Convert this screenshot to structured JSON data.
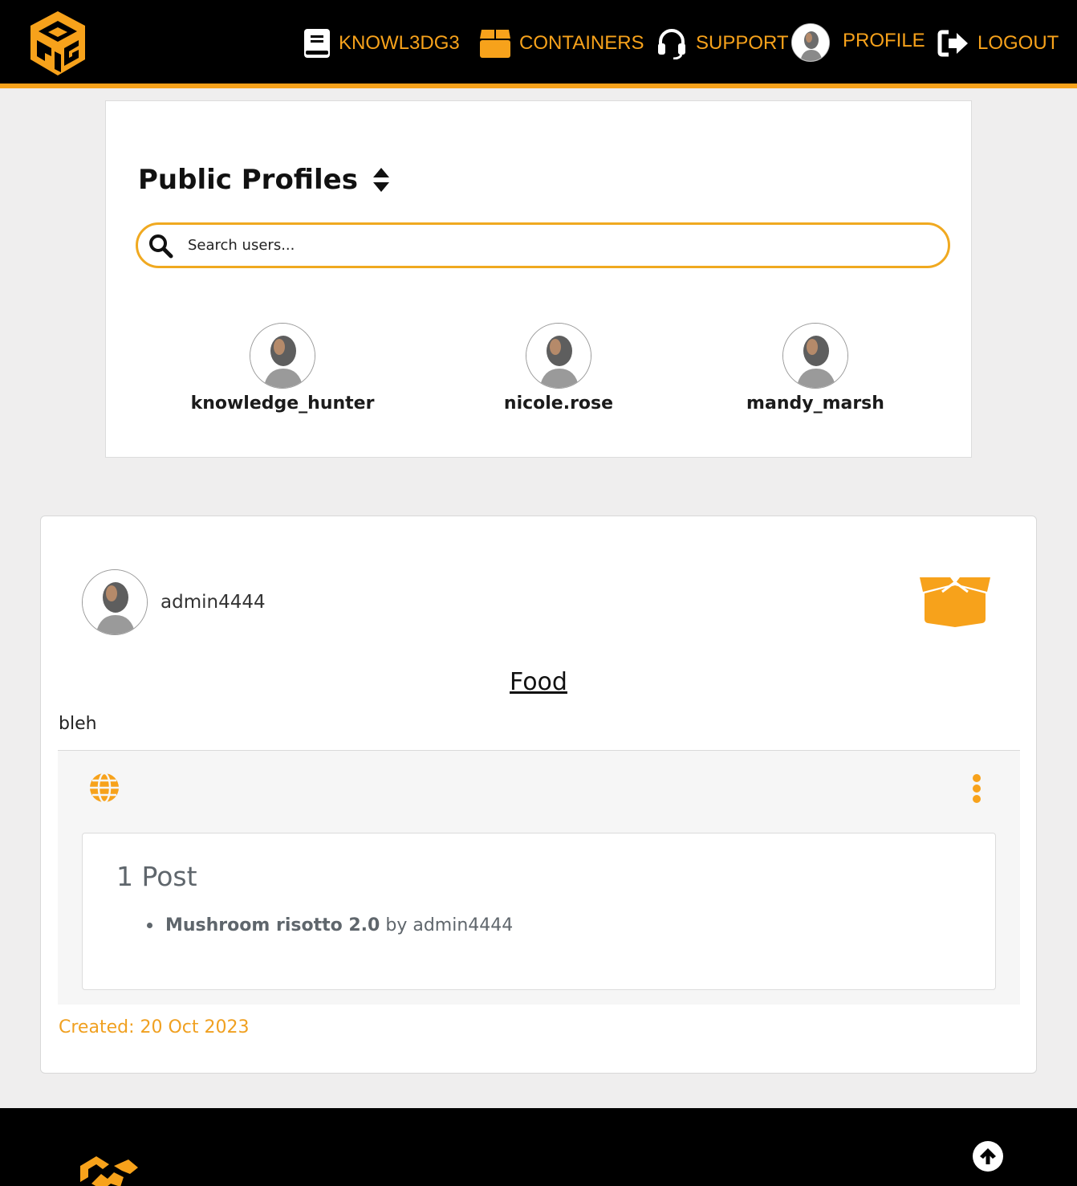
{
  "brand": {
    "accent": "#f7a21b",
    "nav_bg": "#000000"
  },
  "nav": {
    "items": [
      {
        "label": "KNOWL3DG3",
        "icon": "book-icon"
      },
      {
        "label": "CONTAINERS",
        "icon": "box-icon"
      },
      {
        "label": "SUPPORT",
        "icon": "headset-icon"
      },
      {
        "label": "PROFILE",
        "icon": "avatar"
      },
      {
        "label": "LOGOUT",
        "icon": "logout-icon"
      }
    ]
  },
  "profiles": {
    "title": "Public Profiles",
    "search_placeholder": "Search users...",
    "users": [
      {
        "name": "knowledge_hunter"
      },
      {
        "name": "nicole.rose"
      },
      {
        "name": "mandy_marsh"
      }
    ]
  },
  "container": {
    "owner": "admin4444",
    "title": "Food",
    "description": "bleh",
    "posts_count_label": "1 Post",
    "posts": [
      {
        "title": "Mushroom risotto 2.0",
        "by_text": "by",
        "author": "admin4444"
      }
    ],
    "created_label": "Created: 20 Oct 2023"
  }
}
